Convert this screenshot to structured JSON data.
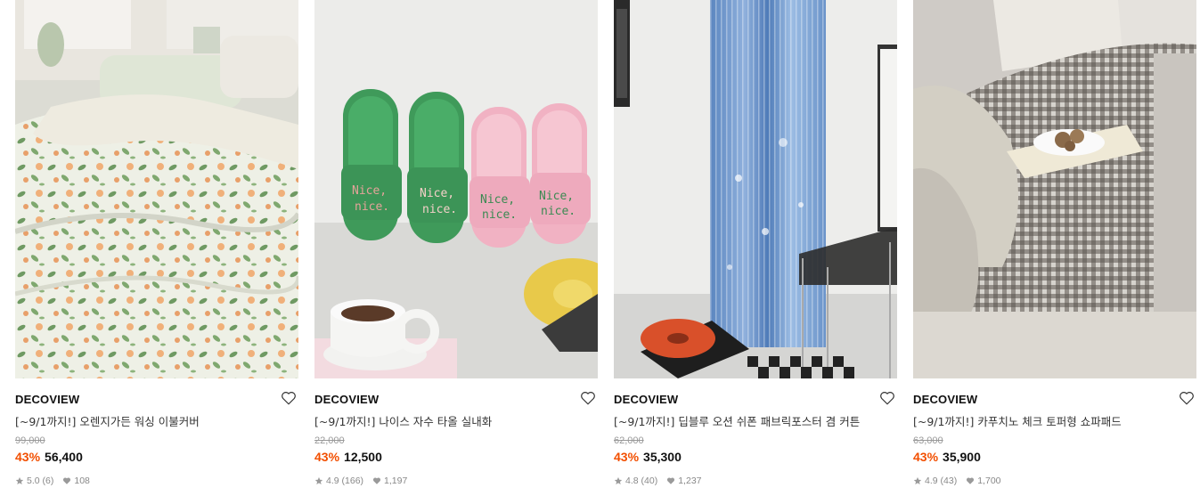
{
  "products": [
    {
      "brand": "DECOVIEW",
      "title": "[~9/1까지!] 오렌지가든 워싱 이불커버",
      "original_price": "99,000",
      "discount": "43%",
      "price": "56,400",
      "rating": "5.0",
      "reviews": "(6)",
      "likes": "108",
      "image_alt": "floral-duvet-cover-photo"
    },
    {
      "brand": "DECOVIEW",
      "title": "[~9/1까지!] 나이스 자수 타올 실내화",
      "original_price": "22,000",
      "discount": "43%",
      "price": "12,500",
      "rating": "4.9",
      "reviews": "(166)",
      "likes": "1,197",
      "image_alt": "towel-slippers-photo"
    },
    {
      "brand": "DECOVIEW",
      "title": "[~9/1까지!] 딥블루 오션 쉬폰 패브릭포스터 겸 커튼",
      "original_price": "62,000",
      "discount": "43%",
      "price": "35,300",
      "rating": "4.8",
      "reviews": "(40)",
      "likes": "1,237",
      "image_alt": "chiffon-curtain-photo"
    },
    {
      "brand": "DECOVIEW",
      "title": "[~9/1까지!] 카푸치노 체크 토퍼형 쇼파패드",
      "original_price": "63,000",
      "discount": "43%",
      "price": "35,900",
      "rating": "4.9",
      "reviews": "(43)",
      "likes": "1,700",
      "image_alt": "check-sofa-pad-photo"
    }
  ],
  "colors": {
    "discount": "#f24f00",
    "meta_gray": "#888888",
    "strike_gray": "#999999"
  },
  "icons": {
    "wishlist": "heart-outline-icon",
    "rating": "star-icon",
    "likes": "heart-filled-icon"
  }
}
